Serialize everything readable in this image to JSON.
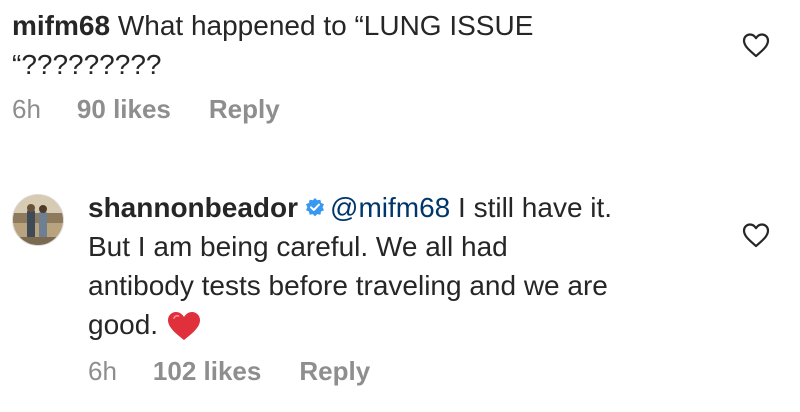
{
  "comments": [
    {
      "username": "mifm68",
      "text": "What happened to “LUNG ISSUE “?????????",
      "text_line1": " What happened to “LUNG ISSUE",
      "text_line2": "“?????????",
      "time": "6h",
      "likes": "90 likes",
      "reply": "Reply",
      "like_icon": "heart-outline-icon"
    },
    {
      "username": "shannonbeador",
      "verified": true,
      "verified_icon": "verified-badge-icon",
      "mention": "@mifm68",
      "text_line1": " I still have it.",
      "text_line2": "But I am being careful. We all had",
      "text_line3": "antibody tests before traveling and we are",
      "text_line4": "good.",
      "emoji": "red-heart-emoji",
      "time": "6h",
      "likes": "102 likes",
      "reply": "Reply",
      "like_icon": "heart-outline-icon",
      "avatar": "profile-photo"
    }
  ],
  "colors": {
    "text": "#262626",
    "meta": "#8e8e8e",
    "mention": "#00376b",
    "verified": "#3897f0",
    "heart": "#ed4956"
  }
}
